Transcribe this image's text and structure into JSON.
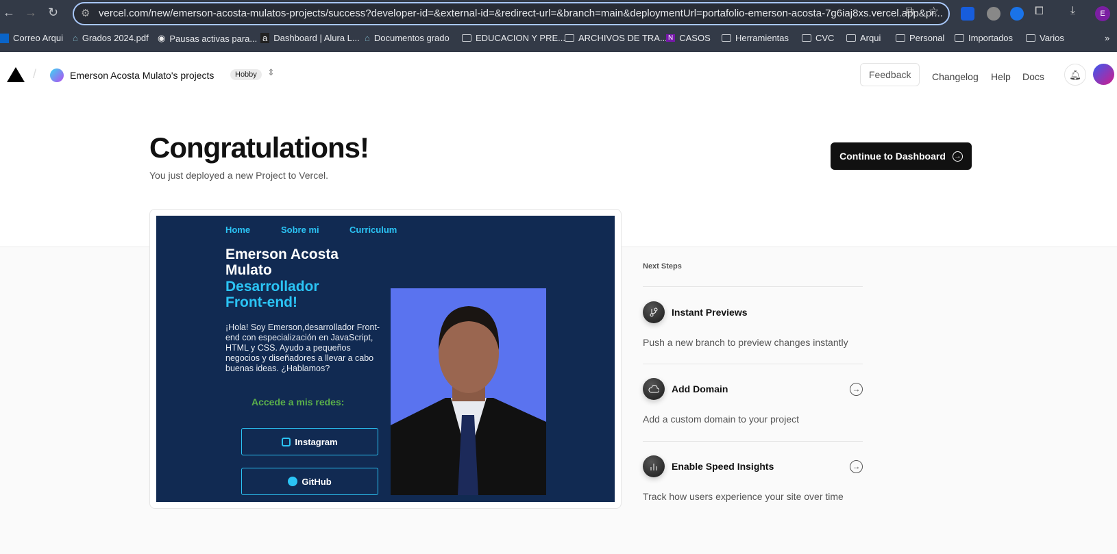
{
  "browser": {
    "url": "vercel.com/new/emerson-acosta-mulatos-projects/success?developer-id=&external-id=&redirect-url=&branch=main&deploymentUrl=portafolio-emerson-acosta-7g6iaj8xs.vercel.app&pr...",
    "profile_initial": "E",
    "bookmarks": [
      "Correo Arqui",
      "Grados 2024.pdf",
      "Pausas activas para...",
      "Dashboard | Alura L...",
      "Documentos grado",
      "EDUCACION Y PRE...",
      "ARCHIVOS DE TRA...",
      "CASOS",
      "Herramientas",
      "CVC",
      "Arqui",
      "Personal",
      "Importados",
      "Varios"
    ]
  },
  "header": {
    "project": "Emerson Acosta Mulato's projects",
    "plan_badge": "Hobby",
    "feedback": "Feedback",
    "changelog": "Changelog",
    "help": "Help",
    "docs": "Docs"
  },
  "hero": {
    "title": "Congratulations!",
    "subtitle": "You just deployed a new Project to Vercel.",
    "cta": "Continue to Dashboard"
  },
  "preview": {
    "nav": [
      "Home",
      "Sobre mi",
      "Curriculum"
    ],
    "name": "Emerson Acosta Mulato",
    "role": "Desarrollador Front-end!",
    "bio": "¡Hola! Soy Emerson,desarrollador Front-end con especialización en JavaScript, HTML y CSS. Ayudo a pequeños negocios y diseñadores a llevar a cabo buenas ideas. ¿Hablamos?",
    "social_heading": "Accede a mis redes:",
    "instagram": "Instagram",
    "github": "GitHub"
  },
  "next_steps": {
    "heading": "Next Steps",
    "items": [
      {
        "title": "Instant Previews",
        "desc": "Push a new branch to preview changes instantly",
        "icon": "git-branch-icon"
      },
      {
        "title": "Add Domain",
        "desc": "Add a custom domain to your project",
        "icon": "cloud-icon"
      },
      {
        "title": "Enable Speed Insights",
        "desc": "Track how users experience your site over time",
        "icon": "bar-chart-icon"
      }
    ]
  }
}
